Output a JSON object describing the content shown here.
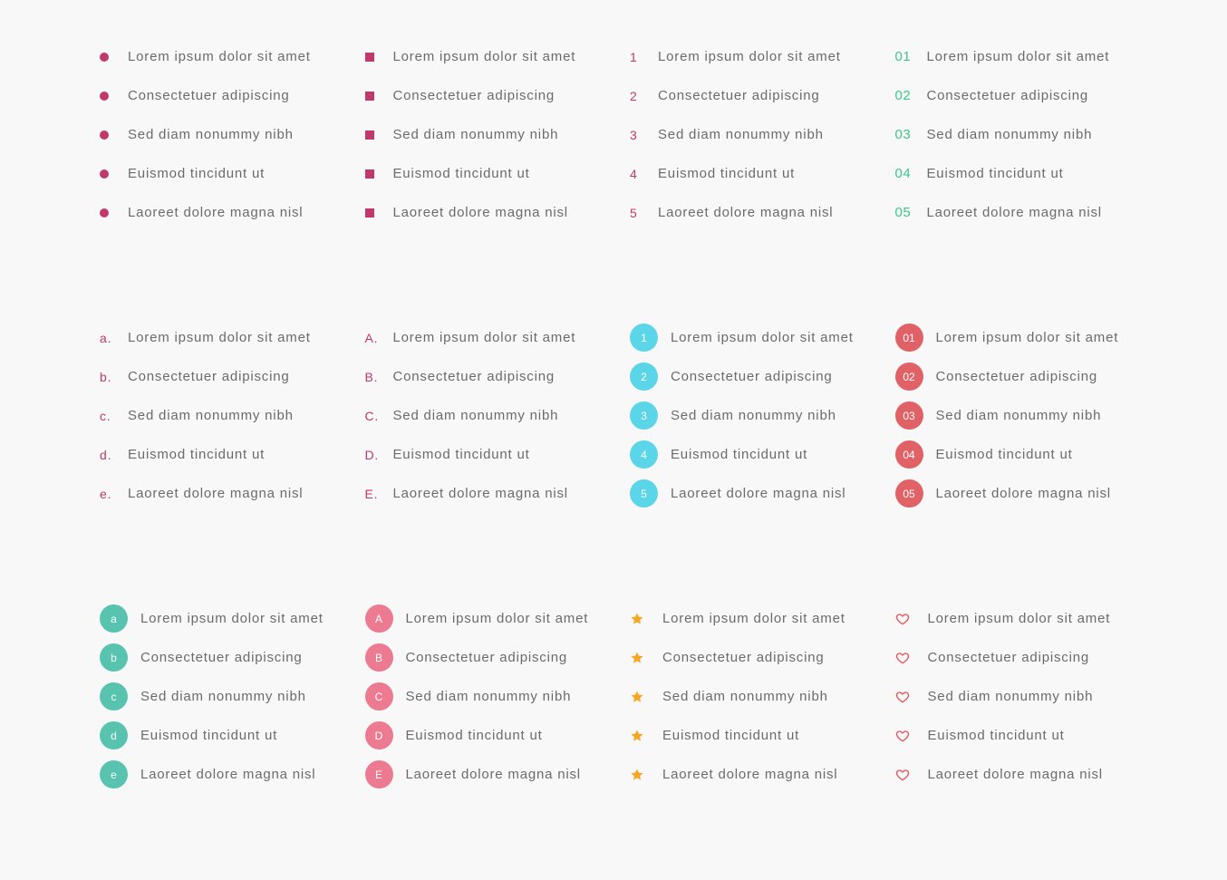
{
  "items": [
    "Lorem ipsum dolor sit amet",
    "Consectetuer adipiscing",
    "Sed diam nonummy nibh",
    "Euismod tincidunt ut",
    "Laoreet dolore magna nisl"
  ],
  "markers": {
    "numbers": [
      "1",
      "2",
      "3",
      "4",
      "5"
    ],
    "zero_numbers": [
      "01",
      "02",
      "03",
      "04",
      "05"
    ],
    "lower_alpha": [
      "a.",
      "b.",
      "c.",
      "d.",
      "e."
    ],
    "upper_alpha": [
      "A.",
      "B.",
      "C.",
      "D.",
      "E."
    ],
    "circle_numbers": [
      "1",
      "2",
      "3",
      "4",
      "5"
    ],
    "circle_zero_numbers": [
      "01",
      "02",
      "03",
      "04",
      "05"
    ],
    "circle_lower": [
      "a",
      "b",
      "c",
      "d",
      "e"
    ],
    "circle_upper": [
      "A",
      "B",
      "C",
      "D",
      "E"
    ]
  },
  "lists": [
    {
      "style": "dot",
      "icon": "bullet-dot-icon"
    },
    {
      "style": "square",
      "icon": "bullet-square-icon"
    },
    {
      "style": "num",
      "marker_key": "numbers"
    },
    {
      "style": "num2",
      "marker_key": "zero_numbers"
    },
    {
      "style": "alpha",
      "marker_key": "lower_alpha"
    },
    {
      "style": "alpha",
      "marker_key": "upper_alpha"
    },
    {
      "style": "circle",
      "color_class": "c-blue",
      "marker_key": "circle_numbers"
    },
    {
      "style": "circle",
      "color_class": "c-red",
      "marker_key": "circle_zero_numbers"
    },
    {
      "style": "circle",
      "color_class": "c-teal",
      "marker_key": "circle_lower"
    },
    {
      "style": "circle",
      "color_class": "c-pink",
      "marker_key": "circle_upper"
    },
    {
      "style": "star",
      "icon": "star-icon"
    },
    {
      "style": "heart",
      "icon": "heart-outline-icon"
    }
  ],
  "colors": {
    "accent_magenta": "#c1386a",
    "accent_green": "#3cc68a",
    "circle_blue": "#5bd6e8",
    "circle_red": "#e06266",
    "circle_teal": "#58c4b0",
    "circle_pink": "#ec7a90",
    "star_orange": "#f5a623",
    "heart_red": "#e8555a",
    "text": "#6b6b6b",
    "background": "#f8f8f8"
  }
}
